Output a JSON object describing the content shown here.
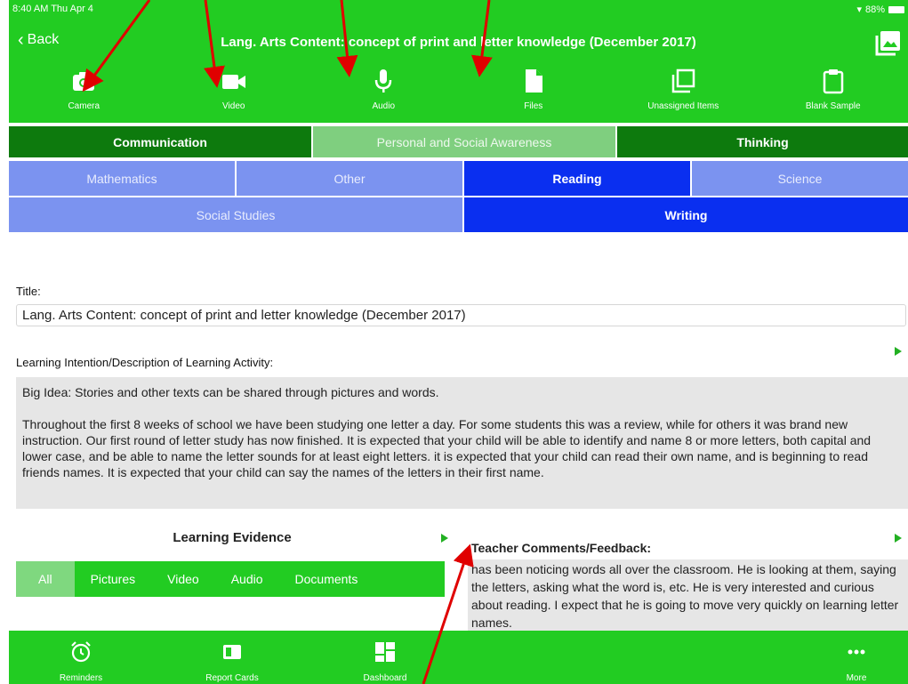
{
  "status": {
    "time": "8:40 AM  Thu Apr 4",
    "battery": "88%"
  },
  "nav": {
    "back_label": "Back",
    "title": "Lang. Arts Content: concept of print and letter knowledge (December 2017)"
  },
  "toolbar": [
    {
      "label": "Camera",
      "icon": "camera-icon"
    },
    {
      "label": "Video",
      "icon": "video-icon"
    },
    {
      "label": "Audio",
      "icon": "microphone-icon"
    },
    {
      "label": "Files",
      "icon": "file-icon"
    },
    {
      "label": "Unassigned Items",
      "icon": "stack-icon"
    },
    {
      "label": "Blank Sample",
      "icon": "clipboard-icon"
    }
  ],
  "core_tabs": [
    {
      "label": "Communication",
      "state": "normal"
    },
    {
      "label": "Personal and Social Awareness",
      "state": "selected"
    },
    {
      "label": "Thinking",
      "state": "normal"
    }
  ],
  "subject_tabs_row1": [
    {
      "label": "Mathematics",
      "state": "unselected"
    },
    {
      "label": "Other",
      "state": "unselected"
    },
    {
      "label": "Reading",
      "state": "selected"
    },
    {
      "label": "Science",
      "state": "unselected"
    }
  ],
  "subject_tabs_row2": [
    {
      "label": "Social Studies",
      "state": "unselected"
    },
    {
      "label": "Writing",
      "state": "selected"
    }
  ],
  "form": {
    "title_label": "Title:",
    "title_value": "Lang. Arts Content: concept of print and letter knowledge (December 2017)",
    "description_label": "Learning Intention/Description of Learning Activity:",
    "description_p1": "Big Idea: Stories and other texts can be shared through pictures and words.",
    "description_p2": "Throughout the first 8 weeks of school we have been studying one letter a day. For some students this was a review, while for others it was brand new instruction. Our first round of letter study has now finished. It is expected that your child will be able to identify and name 8 or more letters, both capital and lower case, and be able to name the letter sounds for at least eight letters. it is expected that your child can read their own name, and is beginning to read friends names. It is expected that your child can say the names of the letters in their first name."
  },
  "evidence": {
    "title": "Learning Evidence",
    "filters": [
      "All",
      "Pictures",
      "Video",
      "Audio",
      "Documents"
    ],
    "active_filter": "All"
  },
  "comments": {
    "label": "Teacher Comments/Feedback:",
    "text": "has been noticing words all over the classroom. He is looking at them, saying the letters, asking what the word is, etc. He is very interested and curious about reading. I expect that he is going to move very quickly on learning letter names."
  },
  "bottom_tabs": [
    {
      "label": "Reminders",
      "icon": "alarm-clock-icon"
    },
    {
      "label": "Report Cards",
      "icon": "report-card-icon"
    },
    {
      "label": "Dashboard",
      "icon": "dashboard-icon"
    },
    {
      "label": "More",
      "icon": "more-dots-icon"
    }
  ],
  "colors": {
    "brand_green": "#22cc22",
    "dark_green": "#0d7a0d",
    "selected_blue": "#0a2ff0",
    "light_blue": "#7b93f0",
    "annotation_red": "#e00000"
  }
}
